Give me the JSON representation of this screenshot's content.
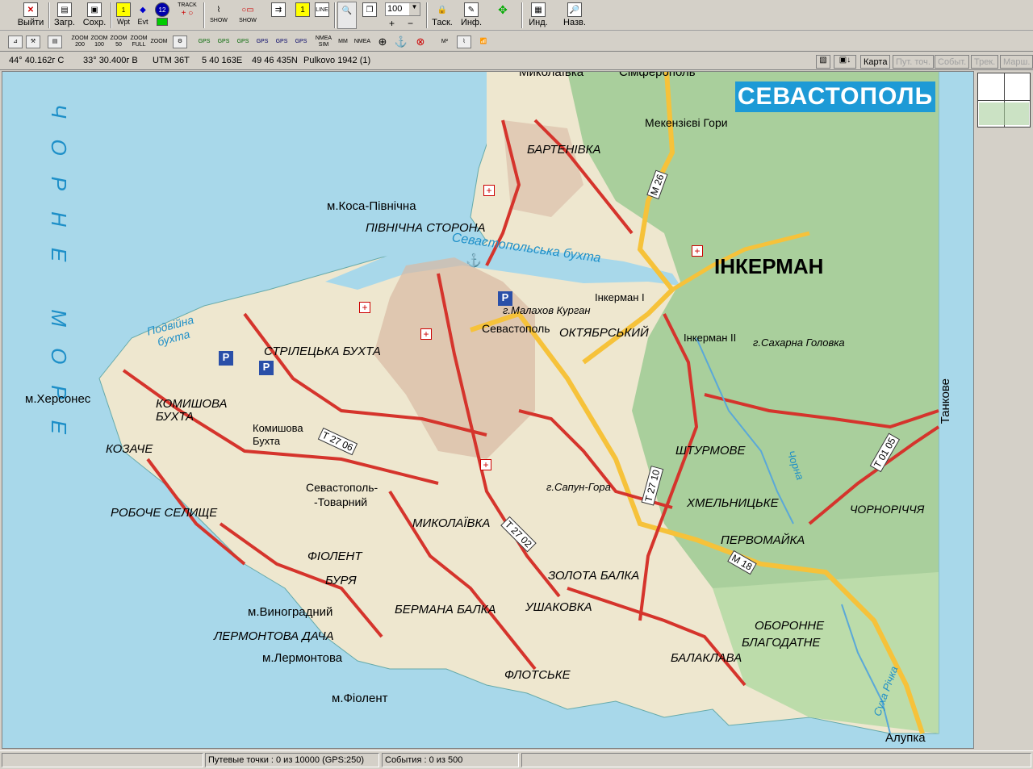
{
  "toolbar": {
    "exit": "Выйти",
    "load": "Загр.",
    "save": "Сохр.",
    "wpt": "Wpt",
    "evt": "Evt",
    "track": "TRACK",
    "show1": "SHOW",
    "show2": "SHOW",
    "zoom_value": "100",
    "task": "Таск.",
    "info": "Инф.",
    "ind": "Инд.",
    "names": "Назв.",
    "twelve": "12"
  },
  "toolbar2": {
    "zoom200_200": "ZOOM 200",
    "zoom200_100": "ZOOM 100",
    "zoom200_50": "ZOOM 50",
    "zoom200_full": "ZOOM FULL",
    "zoom200_grid": "ZOOM",
    "gps": "GPS",
    "nmea_sim": "NMEA SIM",
    "mm": "MM",
    "nmea": "NMEA",
    "m2": "M²"
  },
  "coords": {
    "lat": "44° 40.162г С",
    "lon": "33° 30.400г В",
    "utm": "UTM  36T",
    "easting": "5 40 163E",
    "northing": "49 46 435N",
    "datum": "Pulkovo 1942 (1)"
  },
  "modes": {
    "map": "Карта",
    "waypoints": "Пут. точ.",
    "events": "Событ.",
    "tracks": "Трек.",
    "routes": "Марш."
  },
  "map": {
    "title": "СЕВАСТОПОЛЬ",
    "sea_name": "ЧОРНЕ МОРЕ",
    "bay": "Севастопольська бухта",
    "podviyna": "Подвійна бухта",
    "labels": {
      "mykolaivka_top": "Миколаївка",
      "simferopol": "Сімферополь",
      "mekenzievi": "Мекензієві Гори",
      "bartenivka": "БАРТЕНІВКА",
      "kosa": "м.Коса-Північна",
      "pivnichna": "ПІВНІЧНА СТОРОНА",
      "inkerman": "ІНКЕРМАН",
      "inkerman1": "Інкерман І",
      "inkerman2": "Інкерман ІІ",
      "malakhov": "г.Малахов Курган",
      "sevastopol": "Севастополь",
      "oktyabrsky": "ОКТЯБРСЬКИЙ",
      "sakharna": "г.Сахарна Головка",
      "strilecka": "СТРІЛЕЦЬКА БУХТА",
      "khersones": "м.Херсонес",
      "komyshova": "КОМИШОВА БУХТА",
      "komyshova2": "Комишова Бухта",
      "kozache": "КОЗАЧЕ",
      "tovarny1": "Севастополь-",
      "tovarny2": "-Товарний",
      "sapun": "г.Сапун-Гора",
      "shturmove": "ШТУРМОВЕ",
      "khmelnytske": "ХМЕЛЬНИЦЬКЕ",
      "chornorichya": "ЧОРНОРІЧЧЯ",
      "pervomaika": "ПЕРВОМАЙКА",
      "robochie": "РОБОЧЕ СЕЛИЩЕ",
      "mykolaivka": "МИКОЛАЇВКА",
      "fiolent": "ФІОЛЕНТ",
      "burya": "БУРЯ",
      "zolota": "ЗОЛОТА БАЛКА",
      "vynogradny": "м.Виноградний",
      "bermana": "БЕРМАНА БАЛКА",
      "ushakovka": "УШАКОВКА",
      "lermontova_dacha": "ЛЕРМОНТОВА ДАЧА",
      "lermontova": "м.Лермонтова",
      "oboronne": "ОБОРОННЕ",
      "blagodatne": "БЛАГОДАТНЕ",
      "balaklava": "БАЛАКЛАВА",
      "flotske": "ФЛОТСЬКЕ",
      "fiolent_cape": "м.Фіолент",
      "alupka": "Алупка",
      "tankove": "Танкове",
      "chorna": "Чорна",
      "sukha": "Суха Річка"
    },
    "roads": {
      "m26": "М 26",
      "m18": "М 18",
      "t2706": "Т 27 06",
      "t2702": "Т 27 02",
      "t2710": "Т 27 10",
      "t0105": "Т 01 05"
    }
  },
  "status": {
    "waypoints": "Путевые точки : 0 из 10000  (GPS:250)",
    "events": "События : 0 из 500"
  }
}
